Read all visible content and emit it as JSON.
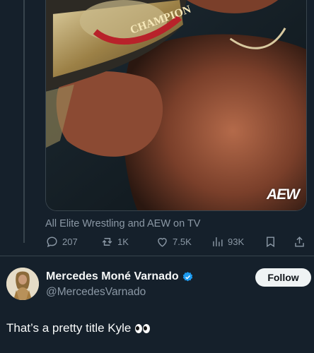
{
  "media": {
    "image_name": "wrestler-holding-championship-belt",
    "belt_text": "CHAMPION",
    "watermark": "AEW"
  },
  "source_line": "All Elite Wrestling and AEW on TV",
  "actions": {
    "replies": "207",
    "reposts": "1K",
    "likes": "7.5K",
    "views": "93K"
  },
  "reply": {
    "display_name": "Mercedes Moné Varnado",
    "handle": "@MercedesVarnado",
    "follow_label": "Follow",
    "text": "That’s a pretty title Kyle",
    "emoji": "eyes-emoji"
  },
  "colors": {
    "background": "#15202b",
    "muted_text": "#8b98a5",
    "verified_blue": "#1d9bf0",
    "follow_button_bg": "#eff3f4"
  }
}
